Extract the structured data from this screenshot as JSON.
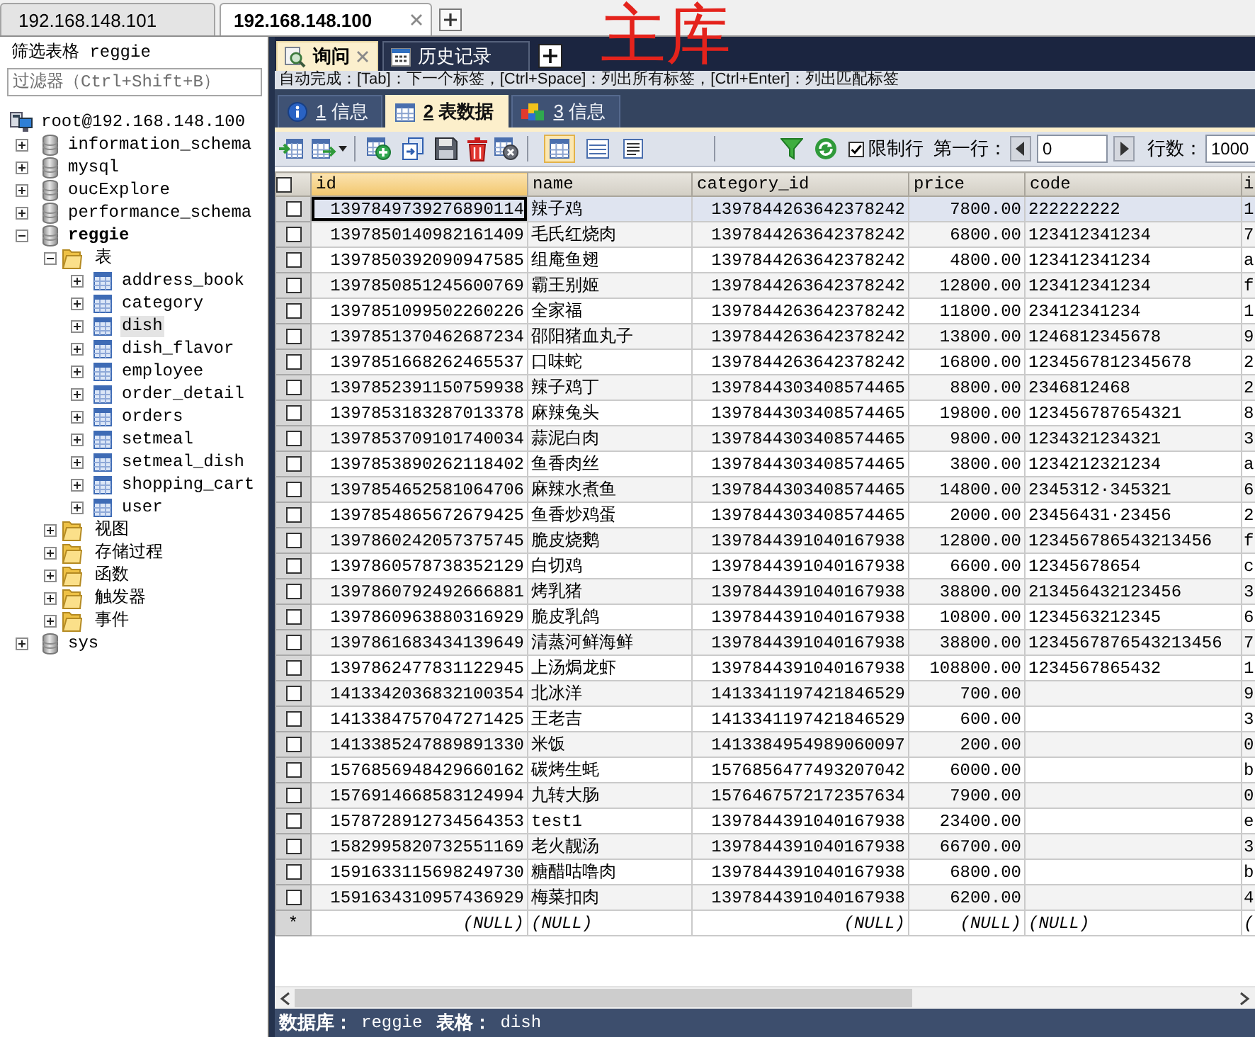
{
  "connection_tabs": [
    {
      "label": "192.168.148.101",
      "selected": false
    },
    {
      "label": "192.168.148.100",
      "selected": true
    }
  ],
  "annotation": "主库",
  "sidebar": {
    "title": "筛选表格 reggie",
    "filter": {
      "placeholder": "过滤器（Ctrl+Shift+B）"
    },
    "tree": [
      {
        "kind": "server",
        "label": "root@192.168.148.100",
        "selected": false,
        "children": [
          {
            "kind": "database",
            "label": "information_schema",
            "expanded": false,
            "selected": false,
            "active": false
          },
          {
            "kind": "database",
            "label": "mysql",
            "expanded": false,
            "selected": false,
            "active": false
          },
          {
            "kind": "database",
            "label": "oucExplore",
            "expanded": false,
            "selected": false,
            "active": false
          },
          {
            "kind": "database",
            "label": "performance_schema",
            "expanded": false,
            "selected": false,
            "active": false
          },
          {
            "kind": "database",
            "label": "reggie",
            "expanded": true,
            "selected": false,
            "active": true,
            "children": [
              {
                "kind": "folder",
                "label": "表",
                "expanded": true,
                "selected": false,
                "children": [
                  {
                    "kind": "table",
                    "label": "address_book",
                    "expanded": false,
                    "selected": false
                  },
                  {
                    "kind": "table",
                    "label": "category",
                    "expanded": false,
                    "selected": false
                  },
                  {
                    "kind": "table",
                    "label": "dish",
                    "expanded": false,
                    "selected": true
                  },
                  {
                    "kind": "table",
                    "label": "dish_flavor",
                    "expanded": false,
                    "selected": false
                  },
                  {
                    "kind": "table",
                    "label": "employee",
                    "expanded": false,
                    "selected": false
                  },
                  {
                    "kind": "table",
                    "label": "order_detail",
                    "expanded": false,
                    "selected": false
                  },
                  {
                    "kind": "table",
                    "label": "orders",
                    "expanded": false,
                    "selected": false
                  },
                  {
                    "kind": "table",
                    "label": "setmeal",
                    "expanded": false,
                    "selected": false
                  },
                  {
                    "kind": "table",
                    "label": "setmeal_dish",
                    "expanded": false,
                    "selected": false
                  },
                  {
                    "kind": "table",
                    "label": "shopping_cart",
                    "expanded": false,
                    "selected": false
                  },
                  {
                    "kind": "table",
                    "label": "user",
                    "expanded": false,
                    "selected": false
                  }
                ]
              },
              {
                "kind": "folder",
                "label": "视图",
                "expanded": false,
                "selected": false
              },
              {
                "kind": "folder",
                "label": "存储过程",
                "expanded": false,
                "selected": false
              },
              {
                "kind": "folder",
                "label": "函数",
                "expanded": false,
                "selected": false
              },
              {
                "kind": "folder",
                "label": "触发器",
                "expanded": false,
                "selected": false
              },
              {
                "kind": "folder",
                "label": "事件",
                "expanded": false,
                "selected": false
              }
            ]
          },
          {
            "kind": "database",
            "label": "sys",
            "expanded": false,
            "selected": false,
            "active": false
          }
        ]
      }
    ]
  },
  "query_tabs": [
    {
      "kind": "query",
      "label": "询问",
      "selected": true
    },
    {
      "kind": "history",
      "label": "历史记录",
      "selected": false
    }
  ],
  "hint": "自动完成：[Tab]：下一个标签，[Ctrl+Space]：列出所有标签，[Ctrl+Enter]：列出匹配标签",
  "result_tabs": [
    {
      "kind": "info",
      "number": "1",
      "label": "信息",
      "selected": false
    },
    {
      "kind": "table",
      "number": "2",
      "label": "表数据",
      "selected": true
    },
    {
      "kind": "messages",
      "number": "3",
      "label": "信息",
      "selected": false
    }
  ],
  "toolbar": {
    "view_modes": [
      {
        "kind": "grid",
        "selected": true
      },
      {
        "kind": "form",
        "selected": false
      },
      {
        "kind": "text",
        "selected": false
      }
    ],
    "limit_rows": {
      "label": "限制行",
      "checked": true
    },
    "first_row": {
      "label": "第一行：",
      "value": "0"
    },
    "row_count": {
      "label": "行数：",
      "value": "1000"
    }
  },
  "table": {
    "select_all": {
      "checked": false
    },
    "columns": [
      {
        "label": "id",
        "selected": true
      },
      {
        "label": "name",
        "selected": false
      },
      {
        "label": "category_id",
        "selected": false
      },
      {
        "label": "price",
        "selected": false
      },
      {
        "label": "code",
        "selected": false
      },
      {
        "label": "i",
        "selected": false
      }
    ],
    "rows": [
      {
        "selected": true,
        "checked": false,
        "id": "1397849739276890114",
        "name": "辣子鸡",
        "category_id": "1397844263642378242",
        "price": "7800.00",
        "code": "222222222",
        "column_6": "1"
      },
      {
        "selected": false,
        "checked": false,
        "id": "1397850140982161409",
        "name": "毛氏红烧肉",
        "category_id": "1397844263642378242",
        "price": "6800.00",
        "code": "123412341234",
        "column_6": "7"
      },
      {
        "selected": false,
        "checked": false,
        "id": "1397850392090947585",
        "name": "组庵鱼翅",
        "category_id": "1397844263642378242",
        "price": "4800.00",
        "code": "123412341234",
        "column_6": "a"
      },
      {
        "selected": false,
        "checked": false,
        "id": "1397850851245600769",
        "name": "霸王别姬",
        "category_id": "1397844263642378242",
        "price": "12800.00",
        "code": "123412341234",
        "column_6": "f"
      },
      {
        "selected": false,
        "checked": false,
        "id": "1397851099502260226",
        "name": "全家福",
        "category_id": "1397844263642378242",
        "price": "11800.00",
        "code": "23412341234",
        "column_6": "1"
      },
      {
        "selected": false,
        "checked": false,
        "id": "1397851370462687234",
        "name": "邵阳猪血丸子",
        "category_id": "1397844263642378242",
        "price": "13800.00",
        "code": "1246812345678",
        "column_6": "9"
      },
      {
        "selected": false,
        "checked": false,
        "id": "1397851668262465537",
        "name": "口味蛇",
        "category_id": "1397844263642378242",
        "price": "16800.00",
        "code": "1234567812345678",
        "column_6": "2"
      },
      {
        "selected": false,
        "checked": false,
        "id": "1397852391150759938",
        "name": "辣子鸡丁",
        "category_id": "1397844303408574465",
        "price": "8800.00",
        "code": "2346812468",
        "column_6": "2"
      },
      {
        "selected": false,
        "checked": false,
        "id": "1397853183287013378",
        "name": "麻辣兔头",
        "category_id": "1397844303408574465",
        "price": "19800.00",
        "code": "123456787654321",
        "column_6": "8"
      },
      {
        "selected": false,
        "checked": false,
        "id": "1397853709101740034",
        "name": "蒜泥白肉",
        "category_id": "1397844303408574465",
        "price": "9800.00",
        "code": "1234321234321",
        "column_6": "3"
      },
      {
        "selected": false,
        "checked": false,
        "id": "1397853890262118402",
        "name": "鱼香肉丝",
        "category_id": "1397844303408574465",
        "price": "3800.00",
        "code": "1234212321234",
        "column_6": "a"
      },
      {
        "selected": false,
        "checked": false,
        "id": "1397854652581064706",
        "name": "麻辣水煮鱼",
        "category_id": "1397844303408574465",
        "price": "14800.00",
        "code": "2345312·345321",
        "column_6": "6"
      },
      {
        "selected": false,
        "checked": false,
        "id": "1397854865672679425",
        "name": "鱼香炒鸡蛋",
        "category_id": "1397844303408574465",
        "price": "2000.00",
        "code": "23456431·23456",
        "column_6": "2"
      },
      {
        "selected": false,
        "checked": false,
        "id": "1397860242057375745",
        "name": "脆皮烧鹅",
        "category_id": "1397844391040167938",
        "price": "12800.00",
        "code": "123456786543213456",
        "column_6": "f"
      },
      {
        "selected": false,
        "checked": false,
        "id": "1397860578738352129",
        "name": "白切鸡",
        "category_id": "1397844391040167938",
        "price": "6600.00",
        "code": "12345678654",
        "column_6": "c"
      },
      {
        "selected": false,
        "checked": false,
        "id": "1397860792492666881",
        "name": "烤乳猪",
        "category_id": "1397844391040167938",
        "price": "38800.00",
        "code": "213456432123456",
        "column_6": "3"
      },
      {
        "selected": false,
        "checked": false,
        "id": "1397860963880316929",
        "name": "脆皮乳鸽",
        "category_id": "1397844391040167938",
        "price": "10800.00",
        "code": "1234563212345",
        "column_6": "6"
      },
      {
        "selected": false,
        "checked": false,
        "id": "1397861683434139649",
        "name": "清蒸河鲜海鲜",
        "category_id": "1397844391040167938",
        "price": "38800.00",
        "code": "1234567876543213456",
        "column_6": "7"
      },
      {
        "selected": false,
        "checked": false,
        "id": "1397862477831122945",
        "name": "上汤焗龙虾",
        "category_id": "1397844391040167938",
        "price": "108800.00",
        "code": "1234567865432",
        "column_6": "1"
      },
      {
        "selected": false,
        "checked": false,
        "id": "1413342036832100354",
        "name": "北冰洋",
        "category_id": "1413341197421846529",
        "price": "700.00",
        "column_6": "9"
      },
      {
        "selected": false,
        "checked": false,
        "id": "1413384757047271425",
        "name": "王老吉",
        "category_id": "1413341197421846529",
        "price": "600.00",
        "column_6": "3"
      },
      {
        "selected": false,
        "checked": false,
        "id": "1413385247889891330",
        "name": "米饭",
        "category_id": "1413384954989060097",
        "price": "200.00",
        "column_6": "0"
      },
      {
        "selected": false,
        "checked": false,
        "id": "1576856948429660162",
        "name": "碳烤生蚝",
        "category_id": "1576856477493207042",
        "price": "6000.00",
        "column_6": "b"
      },
      {
        "selected": false,
        "checked": false,
        "id": "1576914668583124994",
        "name": "九转大肠",
        "category_id": "1576467572172357634",
        "price": "7900.00",
        "column_6": "0"
      },
      {
        "selected": false,
        "checked": false,
        "id": "1578728912734564353",
        "name": "test1",
        "category_id": "1397844391040167938",
        "price": "23400.00",
        "column_6": "e"
      },
      {
        "selected": false,
        "checked": false,
        "id": "1582995820732551169",
        "name": "老火靓汤",
        "category_id": "1397844391040167938",
        "price": "66700.00",
        "column_6": "3"
      },
      {
        "selected": false,
        "checked": false,
        "id": "1591633115698249730",
        "name": "糖醋咕噜肉",
        "category_id": "1397844391040167938",
        "price": "6800.00",
        "column_6": "b"
      },
      {
        "selected": false,
        "checked": false,
        "id": "1591634310957436929",
        "name": "梅菜扣肉",
        "category_id": "1397844391040167938",
        "price": "6200.00",
        "column_6": "4"
      }
    ],
    "new_row": {
      "marker": "*",
      "id": "(NULL)",
      "name": "(NULL)",
      "category_id": "(NULL)",
      "price": "(NULL)",
      "code": "(NULL)",
      "column_6": "("
    }
  },
  "status_bar": {
    "database_label": "数据库：",
    "database": "reggie",
    "table_label": "表格：",
    "table": "dish"
  }
}
